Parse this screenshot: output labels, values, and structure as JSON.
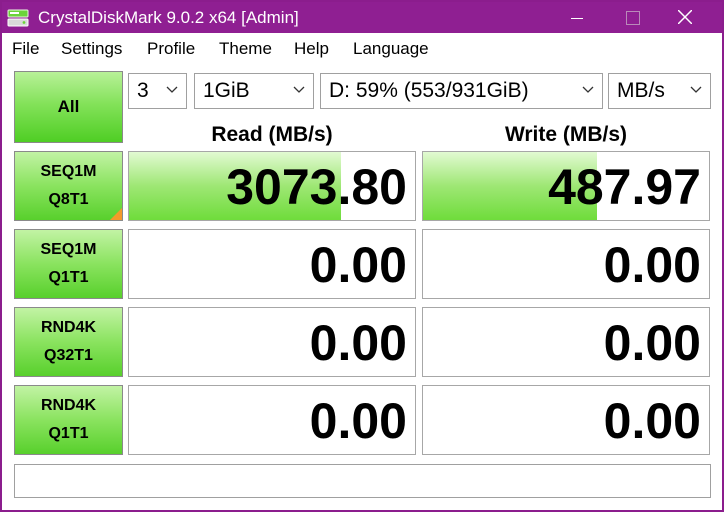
{
  "window": {
    "title": "CrystalDiskMark 9.0.2 x64 [Admin]",
    "titlebar_color": "#8f1f92"
  },
  "menu": [
    "File",
    "Settings",
    "Profile",
    "Theme",
    "Help",
    "Language"
  ],
  "controls": {
    "all_label": "All",
    "count": "3",
    "size": "1GiB",
    "drive": "D: 59% (553/931GiB)",
    "unit": "MB/s"
  },
  "headers": {
    "read": "Read (MB/s)",
    "write": "Write (MB/s)"
  },
  "tests": [
    {
      "line1": "SEQ1M",
      "line2": "Q8T1",
      "read": "3073.80",
      "write": "487.97",
      "read_fill": 0.74,
      "write_fill": 0.61,
      "marked": true
    },
    {
      "line1": "SEQ1M",
      "line2": "Q1T1",
      "read": "0.00",
      "write": "0.00",
      "read_fill": 0,
      "write_fill": 0,
      "marked": false
    },
    {
      "line1": "RND4K",
      "line2": "Q32T1",
      "read": "0.00",
      "write": "0.00",
      "read_fill": 0,
      "write_fill": 0,
      "marked": false
    },
    {
      "line1": "RND4K",
      "line2": "Q1T1",
      "read": "0.00",
      "write": "0.00",
      "read_fill": 0,
      "write_fill": 0,
      "marked": false
    }
  ],
  "status": "",
  "colors": {
    "accent_green": "#6fdc3b",
    "marker_orange": "#f39a2a"
  }
}
